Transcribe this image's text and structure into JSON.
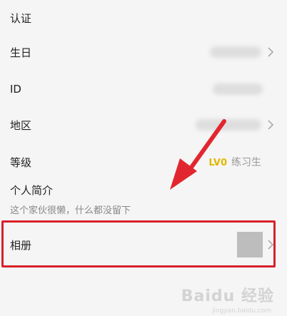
{
  "profile": {
    "rows": [
      {
        "label": "认证"
      },
      {
        "label": "生日"
      },
      {
        "label": "ID"
      },
      {
        "label": "地区"
      },
      {
        "label": "等级",
        "level_badge": "LV0",
        "level_title": "练习生"
      },
      {
        "label": "个人简介",
        "value": "这个家伙很懒，什么都没留下"
      },
      {
        "label": "相册"
      }
    ]
  },
  "annotation": {
    "highlight_color": "#d8202a"
  },
  "watermark": {
    "text": "Baidu 经验",
    "sub": "jingyan.baidu.com"
  },
  "icons": {
    "chevron": "chevron-right-icon",
    "arrow": "red-pointer-arrow"
  }
}
